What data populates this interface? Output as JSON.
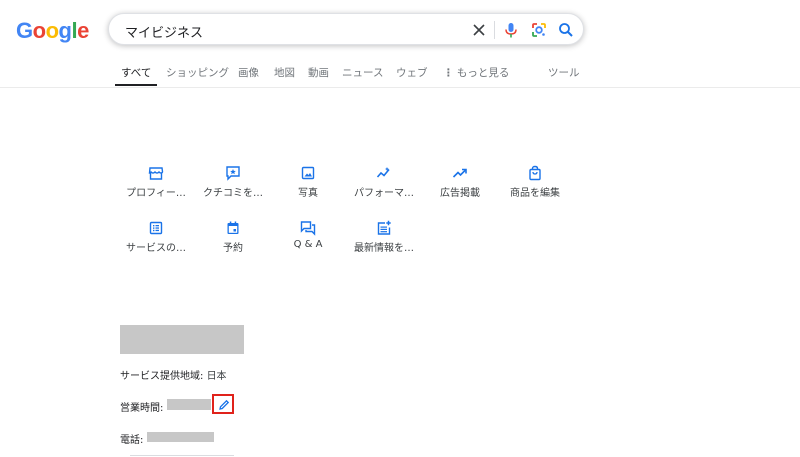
{
  "logo": {
    "letters": [
      "G",
      "o",
      "o",
      "g",
      "l",
      "e"
    ],
    "colors": [
      "#4285F4",
      "#EA4335",
      "#FBBC05",
      "#4285F4",
      "#34A853",
      "#EA4335"
    ]
  },
  "search": {
    "query": "マイビジネス"
  },
  "tabs": [
    {
      "label": "すべて",
      "active": true
    },
    {
      "label": "ショッピング"
    },
    {
      "label": "画像"
    },
    {
      "label": "地図"
    },
    {
      "label": "動画"
    },
    {
      "label": "ニュース"
    },
    {
      "label": "ウェブ"
    },
    {
      "label": "もっと見る"
    },
    {
      "label": "ツール"
    }
  ],
  "actions": [
    {
      "label": "プロフィー…",
      "icon": "storefront-icon"
    },
    {
      "label": "クチコミを…",
      "icon": "review-star-icon"
    },
    {
      "label": "写真",
      "icon": "photo-icon"
    },
    {
      "label": "パフォーマ…",
      "icon": "performance-sparkline-icon"
    },
    {
      "label": "広告掲載",
      "icon": "trending-up-icon"
    },
    {
      "label": "商品を編集",
      "icon": "shopping-bag-icon"
    },
    {
      "label": "サービスの…",
      "icon": "list-icon"
    },
    {
      "label": "予約",
      "icon": "calendar-icon"
    },
    {
      "label": "Q & A",
      "icon": "qa-chat-icon"
    },
    {
      "label": "最新情報を…",
      "icon": "post-add-icon"
    }
  ],
  "info": {
    "service_area_label": "サービス提供地域:",
    "service_area_value": "日本",
    "hours_label": "営業時間:",
    "phone_label": "電話:"
  },
  "colors": {
    "accent": "#1a73e8",
    "highlight": "#e0221b",
    "redacted": "#c7c7c7"
  }
}
